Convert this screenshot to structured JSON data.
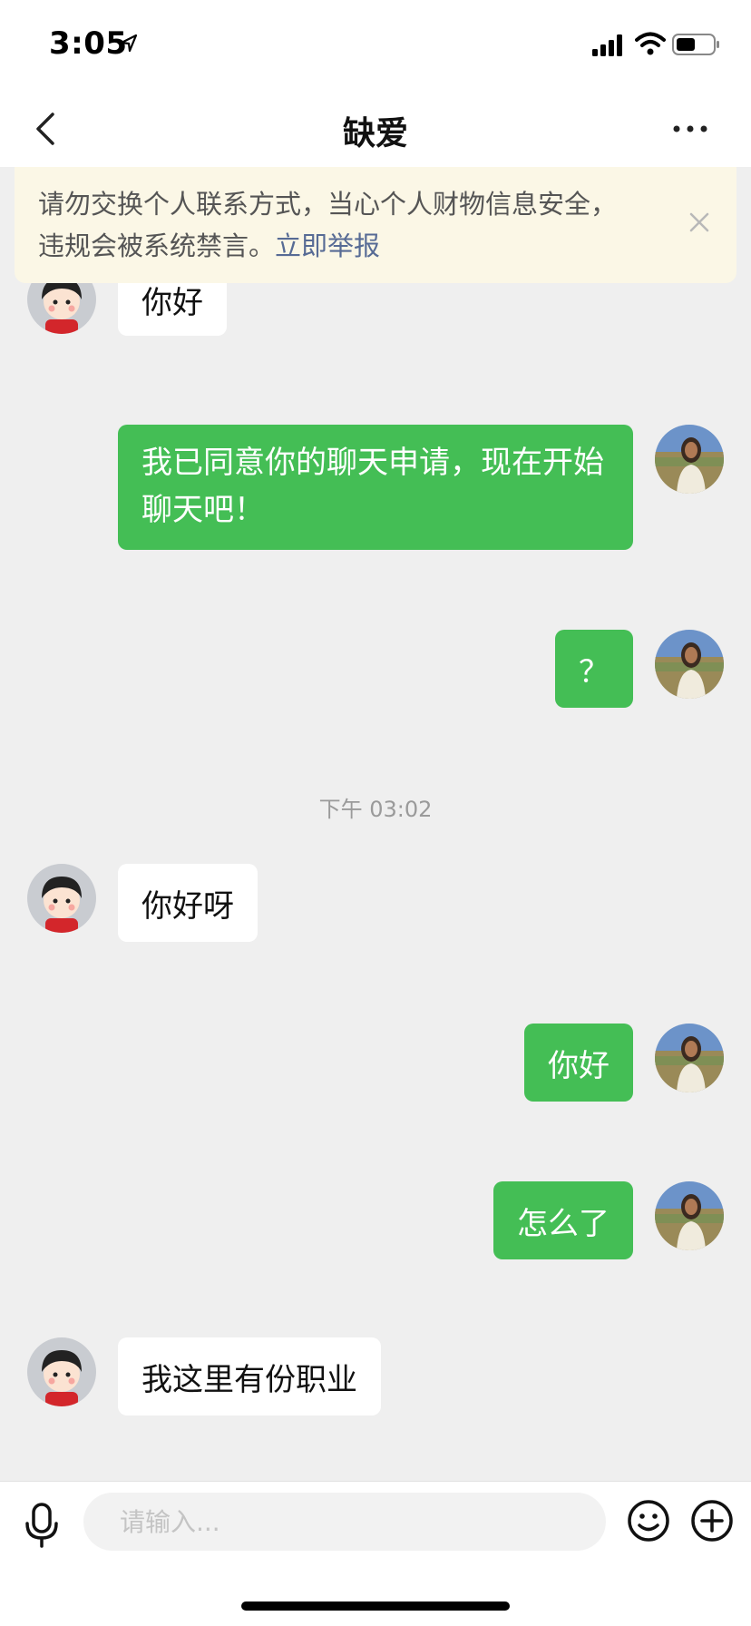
{
  "status_bar": {
    "time": "3:05"
  },
  "header": {
    "title": "缺爱"
  },
  "banner": {
    "text_line1": "请勿交换个人联系方式，当心个人财物信息安全，",
    "text_line2": "违规会被系统禁言。",
    "link": "立即举报"
  },
  "messages": [
    {
      "side": "left",
      "text": "你好"
    },
    {
      "side": "right",
      "line1": "我已同意你的聊天申请，现在开始",
      "line2": "聊天吧！"
    },
    {
      "side": "right",
      "text": "？"
    },
    {
      "side": "left",
      "text": "你好呀"
    },
    {
      "side": "right",
      "text": "你好"
    },
    {
      "side": "right",
      "text": "怎么了"
    },
    {
      "side": "left",
      "text": "我这里有份职业"
    }
  ],
  "timestamp": "下午 03:02",
  "input": {
    "placeholder": "请输入..."
  },
  "colors": {
    "accent_green": "#44be55",
    "link_blue": "#576b95",
    "banner_bg": "#fbf7e6"
  }
}
